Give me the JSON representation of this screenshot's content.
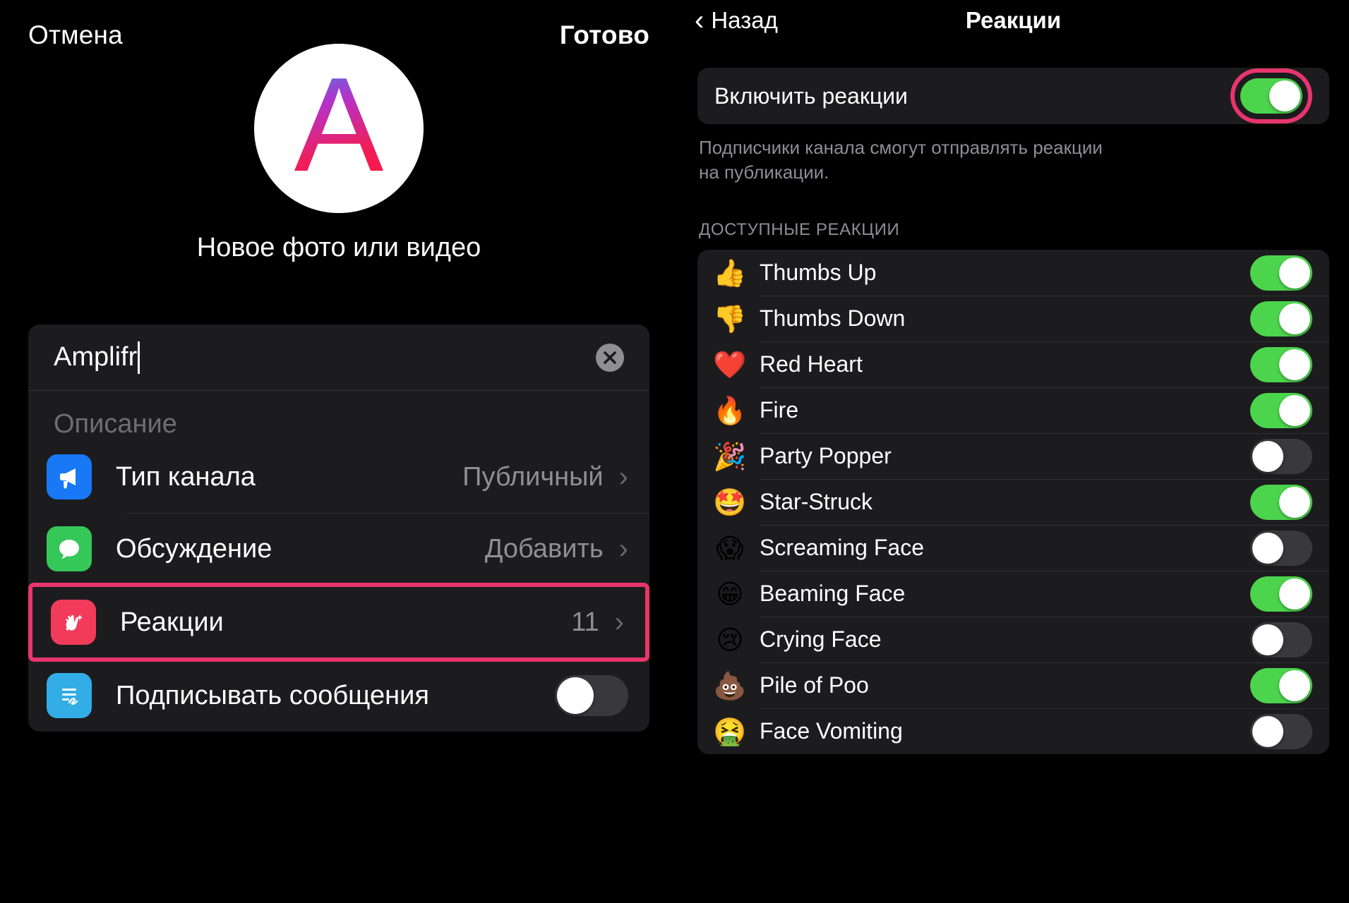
{
  "left": {
    "nav": {
      "cancel": "Отмена",
      "done": "Готово"
    },
    "avatar": {
      "letter": "A"
    },
    "photo_label": "Новое фото или видео",
    "name_field": {
      "value": "Amplifr",
      "clear_icon": "clear-circle-icon"
    },
    "description_field": {
      "placeholder": "Описание"
    },
    "settings": [
      {
        "icon": "megaphone-icon",
        "icon_color": "#1878f5",
        "label": "Тип канала",
        "value": "Публичный",
        "chevron": "›",
        "type": "navigation"
      },
      {
        "icon": "chat-bubble-icon",
        "icon_color": "#36c759",
        "label": "Обсуждение",
        "value": "Добавить",
        "chevron": "›",
        "type": "navigation"
      },
      {
        "icon": "clapping-hands-icon",
        "icon_color": "#f23b5a",
        "label": "Реакции",
        "value": "11",
        "chevron": "›",
        "type": "navigation",
        "highlighted": true
      },
      {
        "icon": "signature-icon",
        "icon_color": "#32ade6",
        "label": "Подписывать сообщения",
        "value": "",
        "type": "toggle",
        "toggle_on": false
      }
    ]
  },
  "right": {
    "nav": {
      "back_label": "Назад",
      "back_icon": "chevron-left-icon",
      "title": "Реакции"
    },
    "enable": {
      "label": "Включить реакции",
      "toggle_on": true,
      "highlighted": true
    },
    "footnote": "Подписчики канала смогут отправлять реакции на публикации.",
    "section_title": "ДОСТУПНЫЕ РЕАКЦИИ",
    "reactions": [
      {
        "emoji": "👍",
        "icon": "thumbs-up-emoji",
        "name": "Thumbs Up",
        "enabled": true
      },
      {
        "emoji": "👎",
        "icon": "thumbs-down-emoji",
        "name": "Thumbs Down",
        "enabled": true
      },
      {
        "emoji": "❤️",
        "icon": "red-heart-emoji",
        "name": "Red Heart",
        "enabled": true
      },
      {
        "emoji": "🔥",
        "icon": "fire-emoji",
        "name": "Fire",
        "enabled": true
      },
      {
        "emoji": "🎉",
        "icon": "party-popper-emoji",
        "name": "Party Popper",
        "enabled": false
      },
      {
        "emoji": "🤩",
        "icon": "star-struck-emoji",
        "name": "Star-Struck",
        "enabled": true
      },
      {
        "emoji": "😱",
        "icon": "screaming-face-emoji",
        "name": "Screaming Face",
        "enabled": false
      },
      {
        "emoji": "😁",
        "icon": "beaming-face-emoji",
        "name": "Beaming Face",
        "enabled": true
      },
      {
        "emoji": "😢",
        "icon": "crying-face-emoji",
        "name": "Crying Face",
        "enabled": false
      },
      {
        "emoji": "💩",
        "icon": "pile-of-poo-emoji",
        "name": "Pile of Poo",
        "enabled": true
      },
      {
        "emoji": "🤮",
        "icon": "face-vomiting-emoji",
        "name": "Face Vomiting",
        "enabled": false
      }
    ]
  },
  "colors": {
    "highlight_pink": "#e8356d",
    "toggle_on_green": "#4cd44c",
    "toggle_off_gray": "#39393d",
    "card_bg": "#1c1c1e",
    "secondary_text": "#8e8e93"
  }
}
